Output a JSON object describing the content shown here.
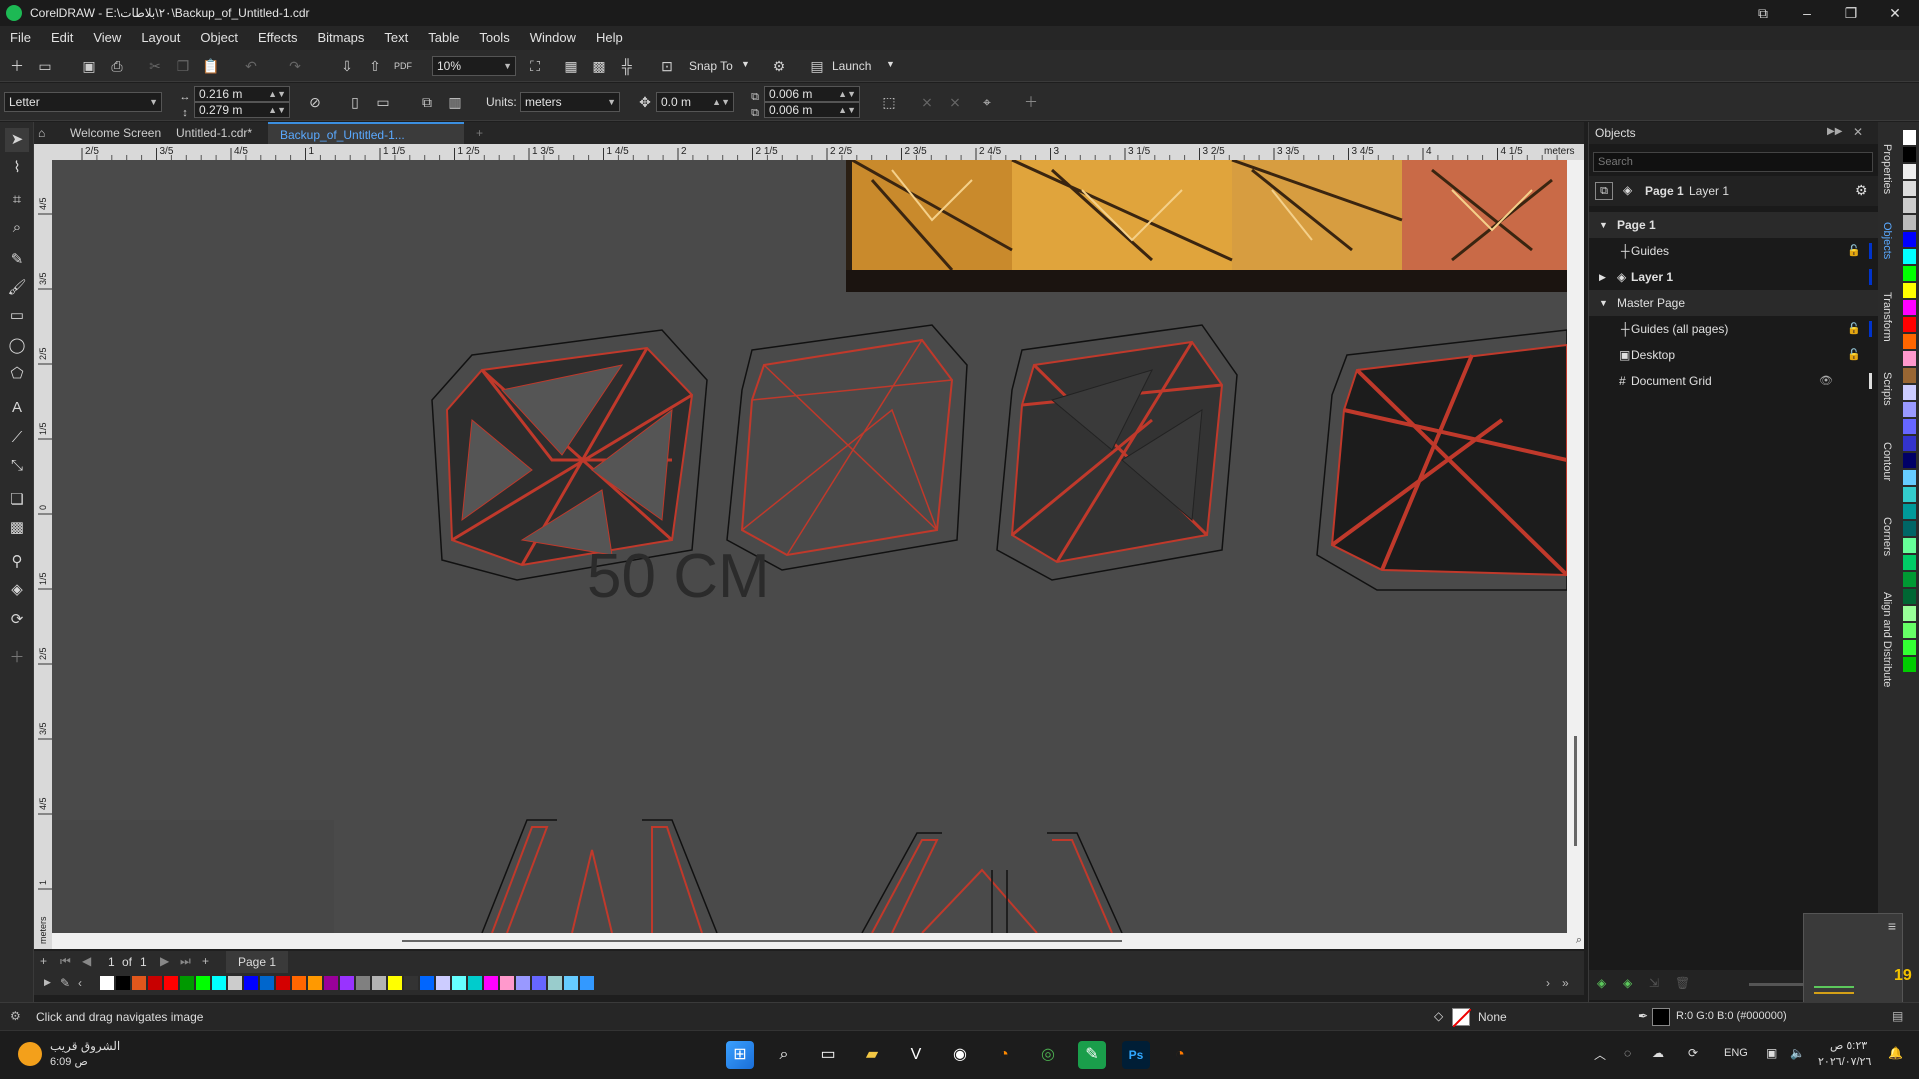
{
  "window": {
    "title": "CorelDRAW - E:\\٢٠\\بلاطات\\Backup_of_Untitled-1.cdr",
    "controls": [
      "⧉",
      "–",
      "❐",
      "✕"
    ]
  },
  "menu": [
    "File",
    "Edit",
    "View",
    "Layout",
    "Object",
    "Effects",
    "Bitmaps",
    "Text",
    "Table",
    "Tools",
    "Window",
    "Help"
  ],
  "standard_toolbar": {
    "zoom": "10%",
    "snap_to": "Snap To",
    "launch": "Launch"
  },
  "property_bar": {
    "page_size": "Letter",
    "width": "0.216 m",
    "height": "0.279 m",
    "units_label": "Units:",
    "units": "meters",
    "nudge": "0.0 m",
    "dup_x": "0.006 m",
    "dup_y": "0.006 m"
  },
  "tabs": [
    "Welcome Screen",
    "Untitled-1.cdr*",
    "Backup_of_Untitled-1..."
  ],
  "ruler": {
    "h_ticks": [
      "2/5",
      "3/5",
      "4/5",
      "1",
      "1 1/5",
      "1 2/5",
      "1 3/5",
      "1 4/5",
      "2",
      "2 1/5",
      "2 2/5",
      "2 3/5",
      "2 4/5",
      "3",
      "3 1/5",
      "3 2/5",
      "3 3/5",
      "3 4/5",
      "4",
      "4 1/5"
    ],
    "h_unit": "meters",
    "v_ticks": [
      "4/5",
      "3/5",
      "2/5",
      "1/5",
      "0",
      "1/5",
      "2/5",
      "3/5",
      "4/5",
      "1"
    ],
    "v_unit": "meters"
  },
  "canvas": {
    "label": "50 CM"
  },
  "page_nav": {
    "of": "1",
    "of_label": "of",
    "total": "1",
    "page_tab": "Page 1"
  },
  "docker": {
    "title": "Objects",
    "search_placeholder": "Search",
    "current_page": "Page 1",
    "current_layer": "Layer 1",
    "tree": [
      {
        "label": "Page 1",
        "level": 0,
        "expanded": true,
        "bold": true
      },
      {
        "label": "Guides",
        "level": 1
      },
      {
        "label": "Layer 1",
        "level": 1,
        "bold": true
      },
      {
        "label": "Master Page",
        "level": 0,
        "expanded": true
      },
      {
        "label": "Guides (all pages)",
        "level": 1
      },
      {
        "label": "Desktop",
        "level": 1
      },
      {
        "label": "Document Grid",
        "level": 1
      }
    ]
  },
  "side_tabs": [
    "Properties",
    "Objects",
    "Transform",
    "Scripts",
    "Contour",
    "Corners",
    "Align and Distribute"
  ],
  "status": {
    "hint": "Click and drag navigates image",
    "fill": "None",
    "outline": "R:0 G:0 B:0 (#000000)"
  },
  "corner_number": "19",
  "taskbar": {
    "weather_title": "الشروق قريب",
    "weather_time": "6:09 ص",
    "lang": "ENG",
    "time": "٥:٢٣ ص",
    "date": "٢٠٢٦/٠٧/٢٦"
  },
  "colors": {
    "accent": "#3b8fe0",
    "guide_red": "#c0392b",
    "canvas_bg": "#4a4a4a"
  },
  "palette_colors": [
    "#ffffff",
    "#000000",
    "#e0571c",
    "#c80000",
    "#ff0000",
    "#009900",
    "#00ff00",
    "#00ffff",
    "#cccccc",
    "#0000ff",
    "#0066cc",
    "#d40000",
    "#ff6600",
    "#ff9900",
    "#990099",
    "#9933ff",
    "#808080",
    "#b3b3b3",
    "#ffff00",
    "#333333",
    "#0066ff",
    "#ccccff",
    "#66ffff",
    "#00cccc",
    "#ff00ff",
    "#ff99cc",
    "#9999ff",
    "#6666ff",
    "#99cccc",
    "#66ccff",
    "#3399ff"
  ],
  "right_palette": [
    "#ffffff",
    "#000000",
    "#eeeeee",
    "#dddddd",
    "#cccccc",
    "#bbbbbb",
    "#0000ff",
    "#00ffff",
    "#00ff00",
    "#ffff00",
    "#ff00ff",
    "#ff0000",
    "#ff6600",
    "#ff99cc",
    "#996633",
    "#ccccff",
    "#9999ff",
    "#6666ff",
    "#3333cc",
    "#000066",
    "#66ccff",
    "#33cccc",
    "#009999",
    "#006666",
    "#66ff99",
    "#00cc66",
    "#009933",
    "#006633",
    "#99ff99",
    "#66ff66",
    "#33ff33",
    "#00cc00"
  ]
}
